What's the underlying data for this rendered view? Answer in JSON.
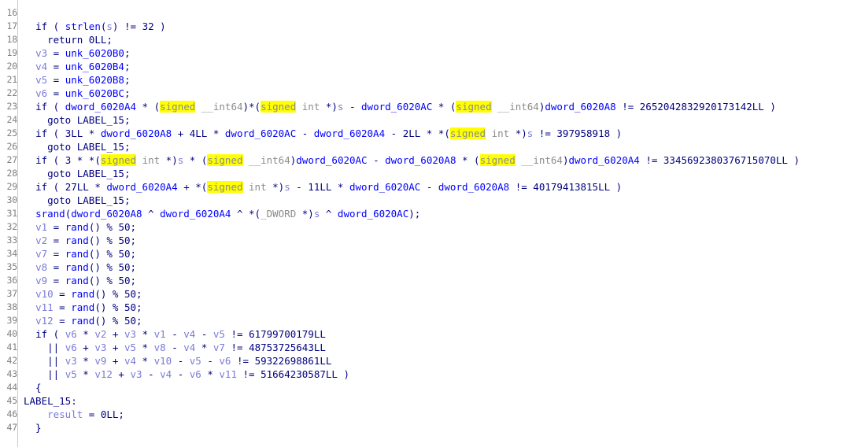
{
  "view": {
    "name": "hex-rays-pseudocode",
    "background": "#ffffff",
    "gutter_rule_color": "#c8c8c8",
    "highlight_color": "#ffff00",
    "colors": {
      "keyword": "#00007f",
      "local_var": "#7b7bd8",
      "global_sym": "#0000ff",
      "type": "#8c8c8c",
      "line_number": "#808080"
    },
    "highlight_term": "signed"
  },
  "lines": [
    {
      "no": "",
      "text": "",
      "clipped": true
    },
    {
      "no": "16",
      "text": ""
    },
    {
      "no": "17",
      "text": "  if ( strlen(s) != 32 )"
    },
    {
      "no": "18",
      "text": "    return 0LL;"
    },
    {
      "no": "19",
      "text": "  v3 = unk_6020B0;"
    },
    {
      "no": "20",
      "text": "  v4 = unk_6020B4;"
    },
    {
      "no": "21",
      "text": "  v5 = unk_6020B8;"
    },
    {
      "no": "22",
      "text": "  v6 = unk_6020BC;"
    },
    {
      "no": "23",
      "text": "  if ( dword_6020A4 * (signed __int64)*(signed int *)s - dword_6020AC * (signed __int64)dword_6020A8 != 2652042832920173142LL )"
    },
    {
      "no": "24",
      "text": "    goto LABEL_15;"
    },
    {
      "no": "25",
      "text": "  if ( 3LL * dword_6020A8 + 4LL * dword_6020AC - dword_6020A4 - 2LL * *(signed int *)s != 397958918 )"
    },
    {
      "no": "26",
      "text": "    goto LABEL_15;"
    },
    {
      "no": "27",
      "text": "  if ( 3 * *(signed int *)s * (signed __int64)dword_6020AC - dword_6020A8 * (signed __int64)dword_6020A4 != 3345692380376715070LL )"
    },
    {
      "no": "28",
      "text": "    goto LABEL_15;"
    },
    {
      "no": "29",
      "text": "  if ( 27LL * dword_6020A4 + *(signed int *)s - 11LL * dword_6020AC - dword_6020A8 != 40179413815LL )"
    },
    {
      "no": "30",
      "text": "    goto LABEL_15;"
    },
    {
      "no": "31",
      "text": "  srand(dword_6020A8 ^ dword_6020A4 ^ *(_DWORD *)s ^ dword_6020AC);"
    },
    {
      "no": "32",
      "text": "  v1 = rand() % 50;"
    },
    {
      "no": "33",
      "text": "  v2 = rand() % 50;"
    },
    {
      "no": "34",
      "text": "  v7 = rand() % 50;"
    },
    {
      "no": "35",
      "text": "  v8 = rand() % 50;"
    },
    {
      "no": "36",
      "text": "  v9 = rand() % 50;"
    },
    {
      "no": "37",
      "text": "  v10 = rand() % 50;"
    },
    {
      "no": "38",
      "text": "  v11 = rand() % 50;"
    },
    {
      "no": "39",
      "text": "  v12 = rand() % 50;"
    },
    {
      "no": "40",
      "text": "  if ( v6 * v2 + v3 * v1 - v4 - v5 != 61799700179LL"
    },
    {
      "no": "41",
      "text": "    || v6 + v3 + v5 * v8 - v4 * v7 != 48753725643LL"
    },
    {
      "no": "42",
      "text": "    || v3 * v9 + v4 * v10 - v5 - v6 != 59322698861LL"
    },
    {
      "no": "43",
      "text": "    || v5 * v12 + v3 - v4 - v6 * v11 != 51664230587LL )"
    },
    {
      "no": "44",
      "text": "  {"
    },
    {
      "no": "45",
      "text": "LABEL_15:"
    },
    {
      "no": "46",
      "text": "    result = 0LL;"
    },
    {
      "no": "47",
      "text": "  }"
    }
  ],
  "tokens": {
    "locals": [
      "v1",
      "v2",
      "v3",
      "v4",
      "v5",
      "v6",
      "v7",
      "v8",
      "v9",
      "v10",
      "v11",
      "v12",
      "result",
      "s"
    ],
    "globals": [
      "unk_6020B0",
      "unk_6020B4",
      "unk_6020B8",
      "unk_6020BC",
      "dword_6020A4",
      "dword_6020A8",
      "dword_6020AC"
    ],
    "functions": [
      "strlen",
      "srand",
      "rand"
    ],
    "types": [
      "signed",
      "int",
      "__int64",
      "_DWORD"
    ],
    "keywords": [
      "if",
      "return",
      "goto"
    ],
    "labels": [
      "LABEL_15"
    ],
    "constants": [
      "32",
      "0LL",
      "2652042832920173142LL",
      "397958918",
      "3345692380376715070LL",
      "40179413815LL",
      "50",
      "61799700179LL",
      "48753725643LL",
      "59322698861LL",
      "51664230587LL",
      "3LL",
      "4LL",
      "2LL",
      "3",
      "27LL",
      "11LL"
    ]
  }
}
